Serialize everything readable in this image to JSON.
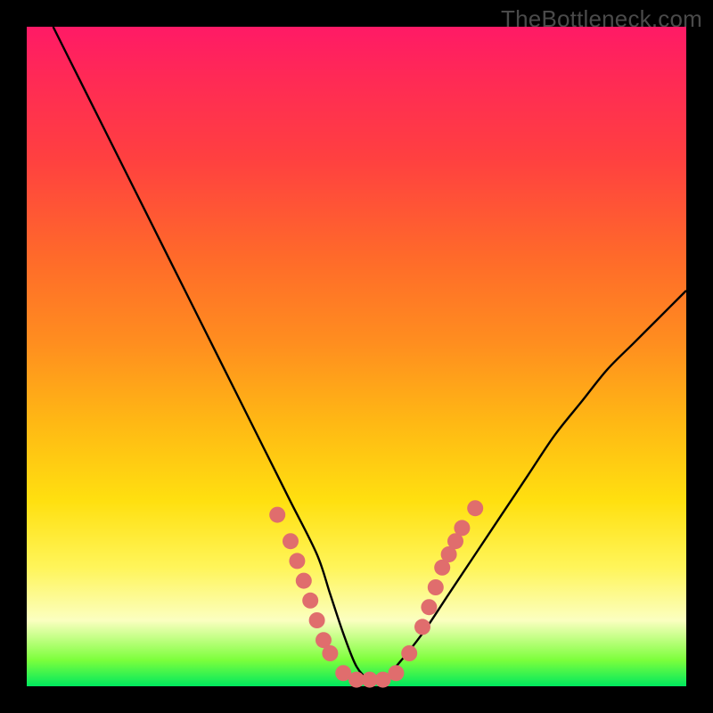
{
  "watermark": "TheBottleneck.com",
  "colors": {
    "frame": "#000000",
    "curve": "#000000",
    "marker_fill": "#e06d6d",
    "marker_stroke": "#d95a5a"
  },
  "chart_data": {
    "type": "line",
    "title": "",
    "xlabel": "",
    "ylabel": "",
    "xlim": [
      0,
      100
    ],
    "ylim": [
      0,
      100
    ],
    "grid": false,
    "legend": false,
    "note": "Single V-shaped bottleneck curve; y axis inverted (0 at bottom = best match). Values estimated from pixel positions; no numeric axis labels are shown in the image.",
    "series": [
      {
        "name": "bottleneck-curve",
        "x": [
          4,
          8,
          12,
          16,
          20,
          24,
          28,
          32,
          36,
          40,
          44,
          46,
          48,
          50,
          52,
          54,
          56,
          60,
          64,
          68,
          72,
          76,
          80,
          84,
          88,
          92,
          96,
          100
        ],
        "y": [
          100,
          92,
          84,
          76,
          68,
          60,
          52,
          44,
          36,
          28,
          20,
          14,
          8,
          3,
          1,
          1,
          3,
          8,
          14,
          20,
          26,
          32,
          38,
          43,
          48,
          52,
          56,
          60
        ]
      }
    ],
    "markers": {
      "name": "highlighted-points",
      "note": "Salmon dots/segments near the valley of the curve on both flanks and across the flat bottom.",
      "points": [
        {
          "x": 38,
          "y": 26
        },
        {
          "x": 40,
          "y": 22
        },
        {
          "x": 41,
          "y": 19
        },
        {
          "x": 42,
          "y": 16
        },
        {
          "x": 43,
          "y": 13
        },
        {
          "x": 44,
          "y": 10
        },
        {
          "x": 45,
          "y": 7
        },
        {
          "x": 46,
          "y": 5
        },
        {
          "x": 48,
          "y": 2
        },
        {
          "x": 50,
          "y": 1
        },
        {
          "x": 52,
          "y": 1
        },
        {
          "x": 54,
          "y": 1
        },
        {
          "x": 56,
          "y": 2
        },
        {
          "x": 58,
          "y": 5
        },
        {
          "x": 60,
          "y": 9
        },
        {
          "x": 61,
          "y": 12
        },
        {
          "x": 62,
          "y": 15
        },
        {
          "x": 63,
          "y": 18
        },
        {
          "x": 64,
          "y": 20
        },
        {
          "x": 65,
          "y": 22
        },
        {
          "x": 66,
          "y": 24
        },
        {
          "x": 68,
          "y": 27
        }
      ]
    }
  }
}
